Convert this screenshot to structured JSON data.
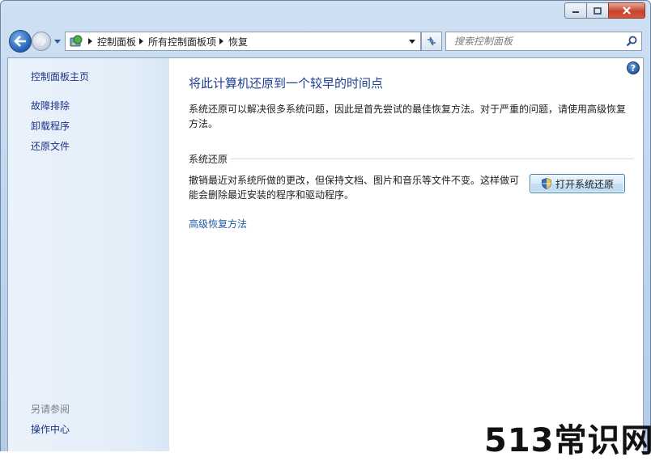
{
  "window": {
    "colors": {
      "accent": "#1e3d8f",
      "link": "#1e3287",
      "sidebar_bg": "#e3eef9",
      "close_red": "#c7432b"
    }
  },
  "toolbar": {
    "breadcrumb": [
      "控制面板",
      "所有控制面板项",
      "恢复"
    ],
    "search_placeholder": "搜索控制面板",
    "icons": [
      "back-arrow-icon",
      "forward-arrow-icon",
      "control-panel-icon",
      "refresh-icon",
      "search-icon"
    ]
  },
  "sidebar": {
    "home": "控制面板主页",
    "links": [
      "故障排除",
      "卸载程序",
      "还原文件"
    ],
    "see_also_title": "另请参阅",
    "see_also_links": [
      "操作中心"
    ]
  },
  "main": {
    "title": "将此计算机还原到一个较早的时间点",
    "intro": "系统还原可以解决很多系统问题，因此是首先尝试的最佳恢复方法。对于严重的问题，请使用高级恢复方法。",
    "section_title": "系统还原",
    "restore_description": "撤销最近对系统所做的更改，但保持文档、图片和音乐等文件不变。这样做可能会删除最近安装的程序和驱动程序。",
    "open_button": "打开系统还原",
    "advanced_link": "高级恢复方法"
  },
  "watermark": "513常识网"
}
